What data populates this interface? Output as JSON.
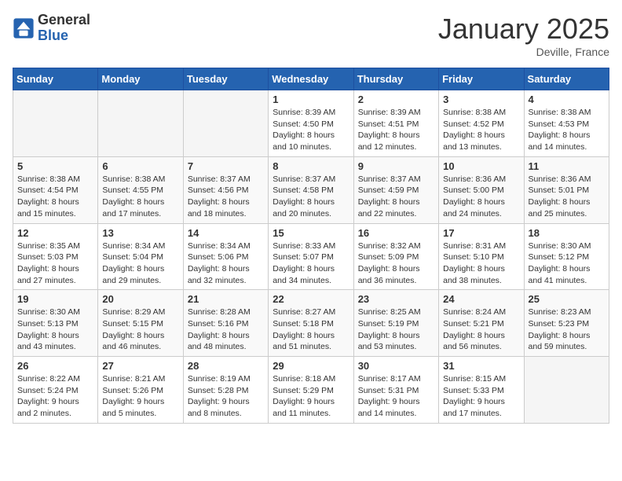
{
  "header": {
    "logo_general": "General",
    "logo_blue": "Blue",
    "month": "January 2025",
    "location": "Deville, France"
  },
  "days_of_week": [
    "Sunday",
    "Monday",
    "Tuesday",
    "Wednesday",
    "Thursday",
    "Friday",
    "Saturday"
  ],
  "weeks": [
    [
      {
        "day": "",
        "info": ""
      },
      {
        "day": "",
        "info": ""
      },
      {
        "day": "",
        "info": ""
      },
      {
        "day": "1",
        "info": "Sunrise: 8:39 AM\nSunset: 4:50 PM\nDaylight: 8 hours\nand 10 minutes."
      },
      {
        "day": "2",
        "info": "Sunrise: 8:39 AM\nSunset: 4:51 PM\nDaylight: 8 hours\nand 12 minutes."
      },
      {
        "day": "3",
        "info": "Sunrise: 8:38 AM\nSunset: 4:52 PM\nDaylight: 8 hours\nand 13 minutes."
      },
      {
        "day": "4",
        "info": "Sunrise: 8:38 AM\nSunset: 4:53 PM\nDaylight: 8 hours\nand 14 minutes."
      }
    ],
    [
      {
        "day": "5",
        "info": "Sunrise: 8:38 AM\nSunset: 4:54 PM\nDaylight: 8 hours\nand 15 minutes."
      },
      {
        "day": "6",
        "info": "Sunrise: 8:38 AM\nSunset: 4:55 PM\nDaylight: 8 hours\nand 17 minutes."
      },
      {
        "day": "7",
        "info": "Sunrise: 8:37 AM\nSunset: 4:56 PM\nDaylight: 8 hours\nand 18 minutes."
      },
      {
        "day": "8",
        "info": "Sunrise: 8:37 AM\nSunset: 4:58 PM\nDaylight: 8 hours\nand 20 minutes."
      },
      {
        "day": "9",
        "info": "Sunrise: 8:37 AM\nSunset: 4:59 PM\nDaylight: 8 hours\nand 22 minutes."
      },
      {
        "day": "10",
        "info": "Sunrise: 8:36 AM\nSunset: 5:00 PM\nDaylight: 8 hours\nand 24 minutes."
      },
      {
        "day": "11",
        "info": "Sunrise: 8:36 AM\nSunset: 5:01 PM\nDaylight: 8 hours\nand 25 minutes."
      }
    ],
    [
      {
        "day": "12",
        "info": "Sunrise: 8:35 AM\nSunset: 5:03 PM\nDaylight: 8 hours\nand 27 minutes."
      },
      {
        "day": "13",
        "info": "Sunrise: 8:34 AM\nSunset: 5:04 PM\nDaylight: 8 hours\nand 29 minutes."
      },
      {
        "day": "14",
        "info": "Sunrise: 8:34 AM\nSunset: 5:06 PM\nDaylight: 8 hours\nand 32 minutes."
      },
      {
        "day": "15",
        "info": "Sunrise: 8:33 AM\nSunset: 5:07 PM\nDaylight: 8 hours\nand 34 minutes."
      },
      {
        "day": "16",
        "info": "Sunrise: 8:32 AM\nSunset: 5:09 PM\nDaylight: 8 hours\nand 36 minutes."
      },
      {
        "day": "17",
        "info": "Sunrise: 8:31 AM\nSunset: 5:10 PM\nDaylight: 8 hours\nand 38 minutes."
      },
      {
        "day": "18",
        "info": "Sunrise: 8:30 AM\nSunset: 5:12 PM\nDaylight: 8 hours\nand 41 minutes."
      }
    ],
    [
      {
        "day": "19",
        "info": "Sunrise: 8:30 AM\nSunset: 5:13 PM\nDaylight: 8 hours\nand 43 minutes."
      },
      {
        "day": "20",
        "info": "Sunrise: 8:29 AM\nSunset: 5:15 PM\nDaylight: 8 hours\nand 46 minutes."
      },
      {
        "day": "21",
        "info": "Sunrise: 8:28 AM\nSunset: 5:16 PM\nDaylight: 8 hours\nand 48 minutes."
      },
      {
        "day": "22",
        "info": "Sunrise: 8:27 AM\nSunset: 5:18 PM\nDaylight: 8 hours\nand 51 minutes."
      },
      {
        "day": "23",
        "info": "Sunrise: 8:25 AM\nSunset: 5:19 PM\nDaylight: 8 hours\nand 53 minutes."
      },
      {
        "day": "24",
        "info": "Sunrise: 8:24 AM\nSunset: 5:21 PM\nDaylight: 8 hours\nand 56 minutes."
      },
      {
        "day": "25",
        "info": "Sunrise: 8:23 AM\nSunset: 5:23 PM\nDaylight: 8 hours\nand 59 minutes."
      }
    ],
    [
      {
        "day": "26",
        "info": "Sunrise: 8:22 AM\nSunset: 5:24 PM\nDaylight: 9 hours\nand 2 minutes."
      },
      {
        "day": "27",
        "info": "Sunrise: 8:21 AM\nSunset: 5:26 PM\nDaylight: 9 hours\nand 5 minutes."
      },
      {
        "day": "28",
        "info": "Sunrise: 8:19 AM\nSunset: 5:28 PM\nDaylight: 9 hours\nand 8 minutes."
      },
      {
        "day": "29",
        "info": "Sunrise: 8:18 AM\nSunset: 5:29 PM\nDaylight: 9 hours\nand 11 minutes."
      },
      {
        "day": "30",
        "info": "Sunrise: 8:17 AM\nSunset: 5:31 PM\nDaylight: 9 hours\nand 14 minutes."
      },
      {
        "day": "31",
        "info": "Sunrise: 8:15 AM\nSunset: 5:33 PM\nDaylight: 9 hours\nand 17 minutes."
      },
      {
        "day": "",
        "info": ""
      }
    ]
  ]
}
